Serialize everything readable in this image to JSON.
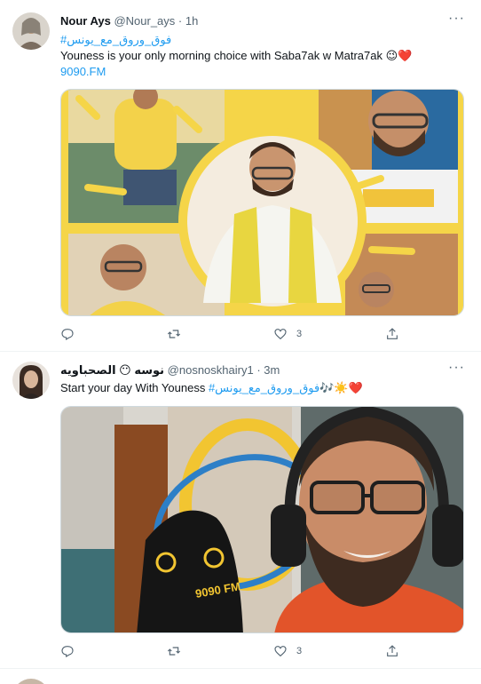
{
  "tweets": [
    {
      "name": "Nour Ays",
      "handle": "@Nour_ays",
      "separator": "·",
      "time": "1h",
      "line1": "#فوق_وروق_مع_يونس",
      "line2": "Youness is your only morning choice with Saba7ak w Matra7ak 😉❤️",
      "line3": "9090.FM",
      "reply_count": "",
      "retweet_count": "",
      "like_count": "3"
    },
    {
      "name": "نوسه 😶 الصحباويه",
      "handle": "@nosnoskhairy1",
      "separator": "·",
      "time": "3m",
      "text_plain": "Start your day With Youness ",
      "hashtag": "#فوق_وروق_مع_يونس",
      "emojis": "🎶☀️❤️",
      "reply_count": "",
      "retweet_count": "",
      "like_count": "3"
    }
  ],
  "more_glyph": "···",
  "mic_text": "9090 FM",
  "colors": {
    "accent": "#1d9bf0",
    "yellow": "#f5d548",
    "muted": "#536471"
  },
  "icons": [
    "reply-icon",
    "retweet-icon",
    "like-icon",
    "share-icon",
    "more-icon"
  ]
}
